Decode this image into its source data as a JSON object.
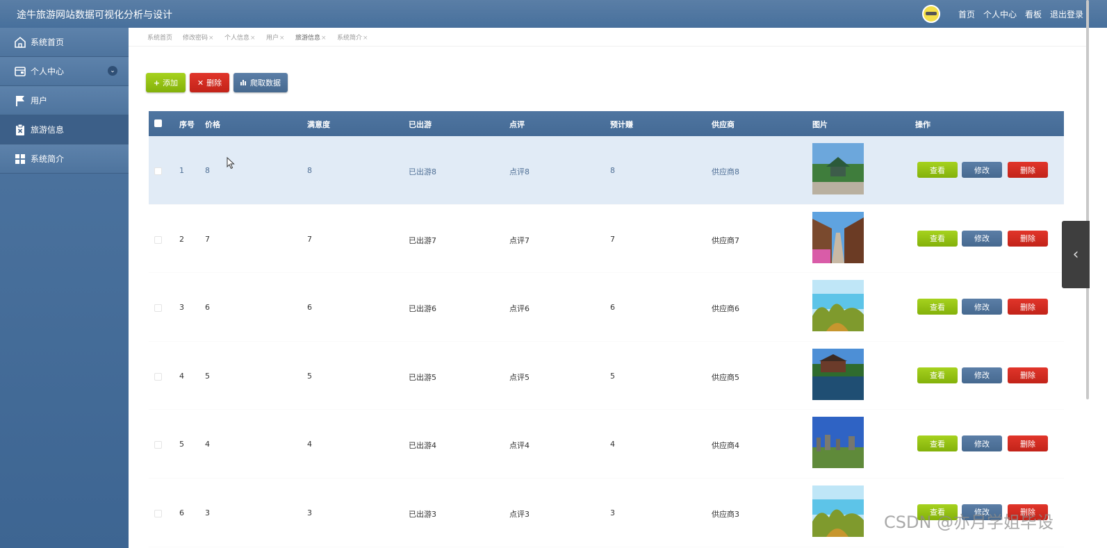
{
  "app": {
    "title": "途牛旅游网站数据可视化分析与设计"
  },
  "topnav": {
    "items": [
      "首页",
      "个人中心",
      "看板",
      "退出登录"
    ]
  },
  "sidebar": {
    "items": [
      {
        "label": "系统首页",
        "icon": "home-icon"
      },
      {
        "label": "个人中心",
        "icon": "wallet-icon",
        "expandable": true
      },
      {
        "label": "用户",
        "icon": "flag-icon"
      },
      {
        "label": "旅游信息",
        "icon": "clipboard-icon",
        "active": true
      },
      {
        "label": "系统简介",
        "icon": "grid-icon"
      }
    ]
  },
  "tabs": [
    {
      "label": "系统首页",
      "closable": false
    },
    {
      "label": "修改密码",
      "closable": true
    },
    {
      "label": "个人信息",
      "closable": true
    },
    {
      "label": "用户",
      "closable": true
    },
    {
      "label": "旅游信息",
      "closable": true,
      "active": true
    },
    {
      "label": "系统简介",
      "closable": true
    }
  ],
  "tab_close": "×",
  "toolbar": {
    "add": "添加",
    "delete": "删除",
    "crawl": "爬取数据"
  },
  "table": {
    "columns": [
      "序号",
      "价格",
      "满意度",
      "已出游",
      "点评",
      "预计赚",
      "供应商",
      "图片",
      "操作"
    ],
    "rows": [
      {
        "no": "1",
        "price": "8",
        "satisfaction": "8",
        "traveled": "已出游8",
        "review": "点评8",
        "estimate": "8",
        "supplier": "供应商8",
        "image": "pavilion-garden"
      },
      {
        "no": "2",
        "price": "7",
        "satisfaction": "7",
        "traveled": "已出游7",
        "review": "点评7",
        "estimate": "7",
        "supplier": "供应商7",
        "image": "old-town-street"
      },
      {
        "no": "3",
        "price": "6",
        "satisfaction": "6",
        "traveled": "已出游6",
        "review": "点评6",
        "estimate": "6",
        "supplier": "供应商6",
        "image": "karst-lake"
      },
      {
        "no": "4",
        "price": "5",
        "satisfaction": "5",
        "traveled": "已出游5",
        "review": "点评5",
        "estimate": "5",
        "supplier": "供应商5",
        "image": "water-town"
      },
      {
        "no": "5",
        "price": "4",
        "satisfaction": "4",
        "traveled": "已出游4",
        "review": "点评4",
        "estimate": "4",
        "supplier": "供应商4",
        "image": "stone-forest"
      },
      {
        "no": "6",
        "price": "3",
        "satisfaction": "3",
        "traveled": "已出游3",
        "review": "点评3",
        "estimate": "3",
        "supplier": "供应商3",
        "image": "karst-lake"
      }
    ],
    "actions": {
      "view": "查看",
      "edit": "修改",
      "delete": "删除"
    }
  },
  "watermark": "CSDN @亦月学姐毕设",
  "colors": {
    "header": "#4a729e",
    "sidebar": "#456c97",
    "green": "#8dba10",
    "red": "#d02c21",
    "blue": "#52749d",
    "highlight_row": "#e1ebf6"
  }
}
